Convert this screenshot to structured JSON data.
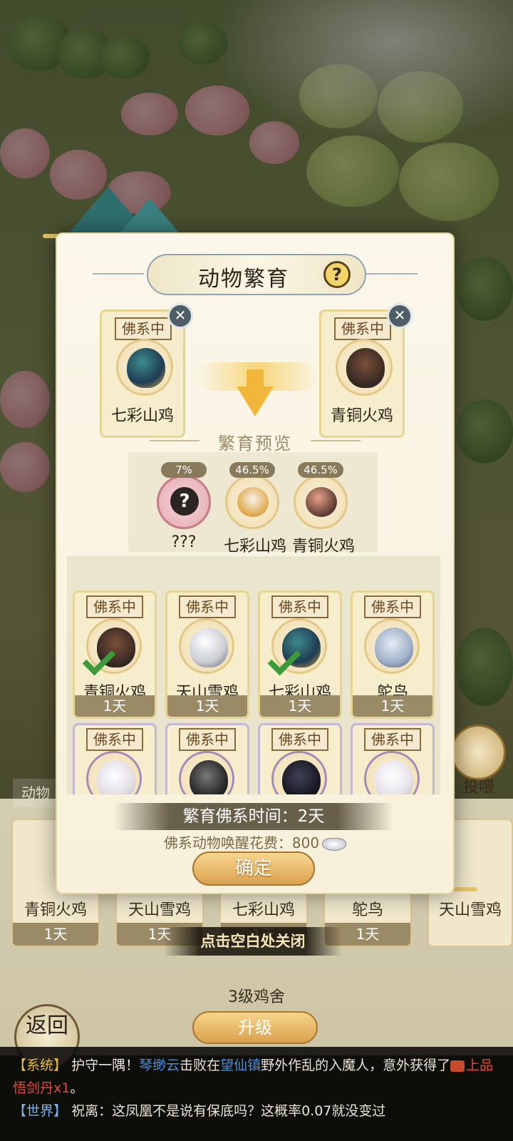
{
  "modal": {
    "title": "动物繁育",
    "help_label": "?",
    "left_parent": {
      "status": "佛系中",
      "name": "七彩山鸡",
      "remove_label": "✕"
    },
    "right_parent": {
      "status": "佛系中",
      "name": "青铜火鸡",
      "remove_label": "✕"
    },
    "preview_label": "繁育预览",
    "preview": [
      {
        "pct": "7%",
        "name": "???"
      },
      {
        "pct": "46.5%",
        "name": "七彩山鸡"
      },
      {
        "pct": "46.5%",
        "name": "青铜火鸡"
      }
    ],
    "animals": [
      {
        "status": "佛系中",
        "name": "青铜火鸡",
        "time": "1天",
        "selected": true,
        "icon": "turkey-icon"
      },
      {
        "status": "佛系中",
        "name": "天山雪鸡",
        "time": "1天",
        "selected": false,
        "icon": "snow-chicken-icon"
      },
      {
        "status": "佛系中",
        "name": "七彩山鸡",
        "time": "1天",
        "selected": true,
        "icon": "pheasant-icon"
      },
      {
        "status": "佛系中",
        "name": "鸵鸟",
        "time": "1天",
        "selected": false,
        "icon": "ostrich-icon"
      },
      {
        "status": "佛系中",
        "name": "",
        "time": "",
        "selected": false,
        "icon": "white-turkey-icon"
      },
      {
        "status": "佛系中",
        "name": "",
        "time": "",
        "selected": false,
        "icon": "rooster-icon"
      },
      {
        "status": "佛系中",
        "name": "",
        "time": "",
        "selected": false,
        "icon": "black-hen-icon"
      },
      {
        "status": "佛系中",
        "name": "",
        "time": "",
        "selected": false,
        "icon": "white-hen-icon"
      }
    ],
    "breed_time": "繁育佛系时间：2天",
    "wake_cost_label": "佛系动物唤醒花费：800",
    "confirm_label": "确定"
  },
  "close_hint": "点击空白处关闭",
  "background": {
    "side_tab": "动物",
    "feed_label": "投喂",
    "cards": [
      {
        "name": "青铜火鸡",
        "time": "1天"
      },
      {
        "name": "天山雪鸡",
        "time": "1天"
      },
      {
        "name": "七彩山鸡",
        "time": "1天"
      },
      {
        "name": "鸵鸟",
        "time": "1天"
      },
      {
        "name": "天山雪鸡",
        "time": ""
      }
    ],
    "level_label": "3级鸡舍",
    "upgrade_label": "升级",
    "return_label": "返回"
  },
  "chat": {
    "line1_tag": "【系统】",
    "line1_a": "护守一隅！",
    "line1_name": "琴缈云",
    "line1_b": "击败在",
    "line1_place": "望仙镇",
    "line1_c": "野外作乱的入魔人，意外获得了",
    "line1_item": "上品悟剑丹x1",
    "line1_end": "。",
    "line2_tag": "【世界】",
    "line2_text": "祝离：这凤凰不是说有保底吗？这概率0.07就没变过"
  },
  "colors": {
    "accent_gold": "#dba250",
    "panel_bg": "#fbf7ea",
    "selected_check": "#3c9a3a",
    "system_tag": "#e2b94a",
    "world_tag": "#7cb2ea"
  }
}
